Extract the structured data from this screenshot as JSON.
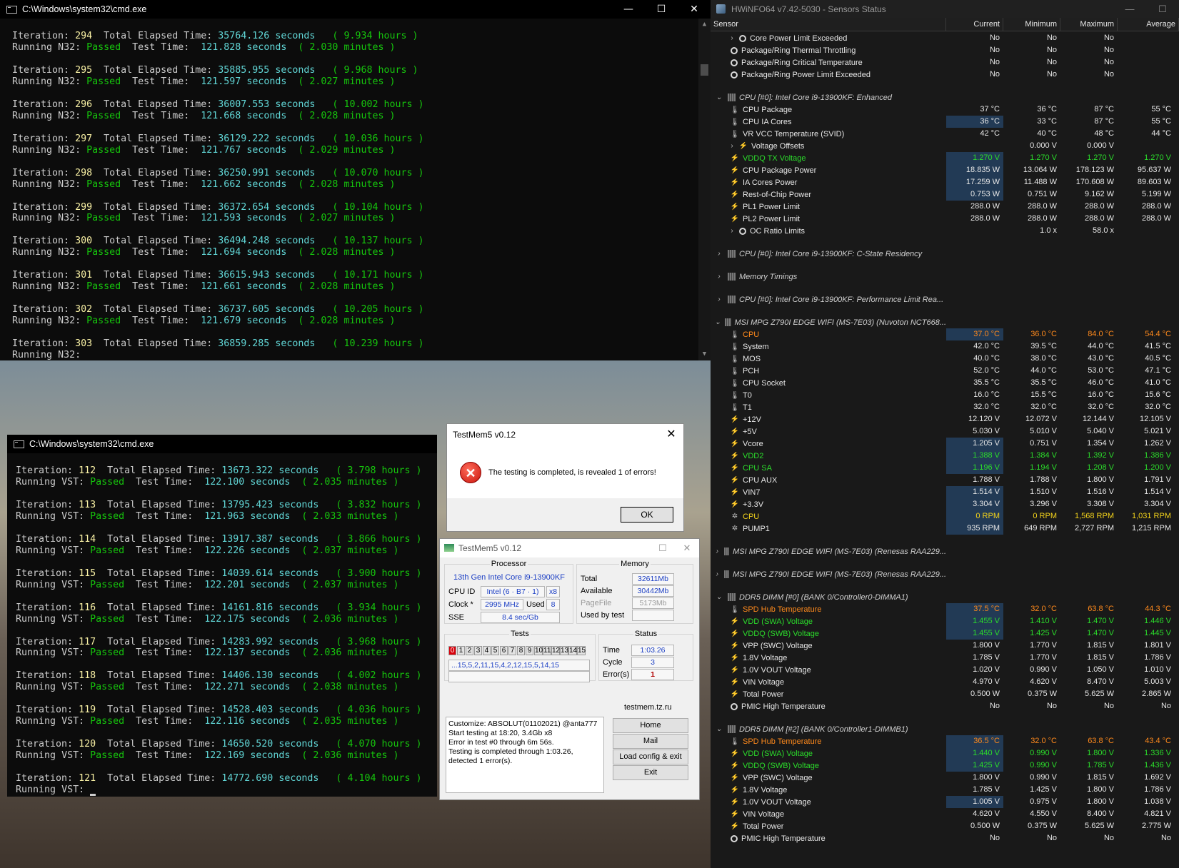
{
  "cmd1": {
    "title": "C:\\Windows\\system32\\cmd.exe",
    "blocks": [
      {
        "iter": "294",
        "elapsed": "35764.126",
        "hours": "9.934",
        "test": "N32:",
        "status": "Passed",
        "ttime": "121.828",
        "minutes": "2.030"
      },
      {
        "iter": "295",
        "elapsed": "35885.955",
        "hours": "9.968",
        "test": "N32:",
        "status": "Passed",
        "ttime": "121.597",
        "minutes": "2.027"
      },
      {
        "iter": "296",
        "elapsed": "36007.553",
        "hours": "10.002",
        "test": "N32:",
        "status": "Passed",
        "ttime": "121.668",
        "minutes": "2.028"
      },
      {
        "iter": "297",
        "elapsed": "36129.222",
        "hours": "10.036",
        "test": "N32:",
        "status": "Passed",
        "ttime": "121.767",
        "minutes": "2.029"
      },
      {
        "iter": "298",
        "elapsed": "36250.991",
        "hours": "10.070",
        "test": "N32:",
        "status": "Passed",
        "ttime": "121.662",
        "minutes": "2.028"
      },
      {
        "iter": "299",
        "elapsed": "36372.654",
        "hours": "10.104",
        "test": "N32:",
        "status": "Passed",
        "ttime": "121.593",
        "minutes": "2.027"
      },
      {
        "iter": "300",
        "elapsed": "36494.248",
        "hours": "10.137",
        "test": "N32:",
        "status": "Passed",
        "ttime": "121.694",
        "minutes": "2.028"
      },
      {
        "iter": "301",
        "elapsed": "36615.943",
        "hours": "10.171",
        "test": "N32:",
        "status": "Passed",
        "ttime": "121.661",
        "minutes": "2.028"
      },
      {
        "iter": "302",
        "elapsed": "36737.605",
        "hours": "10.205",
        "test": "N32:",
        "status": "Passed",
        "ttime": "121.679",
        "minutes": "2.028"
      },
      {
        "iter": "303",
        "elapsed": "36859.285",
        "hours": "10.239",
        "test": "N32:",
        "status": "",
        "ttime": "",
        "minutes": ""
      }
    ]
  },
  "cmd2": {
    "title": "C:\\Windows\\system32\\cmd.exe",
    "blocks": [
      {
        "iter": "112",
        "elapsed": "13673.322",
        "hours": "3.798",
        "test": "VST:",
        "status": "Passed",
        "ttime": "122.100",
        "minutes": "2.035"
      },
      {
        "iter": "113",
        "elapsed": "13795.423",
        "hours": "3.832",
        "test": "VST:",
        "status": "Passed",
        "ttime": "121.963",
        "minutes": "2.033"
      },
      {
        "iter": "114",
        "elapsed": "13917.387",
        "hours": "3.866",
        "test": "VST:",
        "status": "Passed",
        "ttime": "122.226",
        "minutes": "2.037"
      },
      {
        "iter": "115",
        "elapsed": "14039.614",
        "hours": "3.900",
        "test": "VST:",
        "status": "Passed",
        "ttime": "122.201",
        "minutes": "2.037"
      },
      {
        "iter": "116",
        "elapsed": "14161.816",
        "hours": "3.934",
        "test": "VST:",
        "status": "Passed",
        "ttime": "122.175",
        "minutes": "2.036"
      },
      {
        "iter": "117",
        "elapsed": "14283.992",
        "hours": "3.968",
        "test": "VST:",
        "status": "Passed",
        "ttime": "122.137",
        "minutes": "2.036"
      },
      {
        "iter": "118",
        "elapsed": "14406.130",
        "hours": "4.002",
        "test": "VST:",
        "status": "Passed",
        "ttime": "122.271",
        "minutes": "2.038"
      },
      {
        "iter": "119",
        "elapsed": "14528.403",
        "hours": "4.036",
        "test": "VST:",
        "status": "Passed",
        "ttime": "122.116",
        "minutes": "2.035"
      },
      {
        "iter": "120",
        "elapsed": "14650.520",
        "hours": "4.070",
        "test": "VST:",
        "status": "Passed",
        "ttime": "122.169",
        "minutes": "2.036"
      },
      {
        "iter": "121",
        "elapsed": "14772.690",
        "hours": "4.104",
        "test": "VST:",
        "status": "",
        "ttime": "",
        "minutes": ""
      }
    ]
  },
  "console_words": {
    "iteration": "Iteration:",
    "total": "Total Elapsed Time:",
    "seconds": "seconds",
    "hours": "hours",
    "running": "Running",
    "testtime": "Test Time:",
    "minutes": "minutes",
    "open": "(",
    "close": ")"
  },
  "window_buttons": {
    "minimize": "—",
    "maximize": "☐",
    "close": "✕"
  },
  "hwinfo": {
    "title": "HWiNFO64 v7.42-5030 - Sensors Status",
    "columns": [
      "Sensor",
      "Current",
      "Minimum",
      "Maximum",
      "Average"
    ],
    "rows": [
      {
        "k": "sub",
        "icon": "circ",
        "exp": "›",
        "label": "Core Power Limit Exceeded",
        "c": "No",
        "mn": "No",
        "mx": "No",
        "av": ""
      },
      {
        "k": "item",
        "icon": "circ",
        "label": "Package/Ring Thermal Throttling",
        "c": "No",
        "mn": "No",
        "mx": "No",
        "av": ""
      },
      {
        "k": "item",
        "icon": "circ",
        "label": "Package/Ring Critical Temperature",
        "c": "No",
        "mn": "No",
        "mx": "No",
        "av": ""
      },
      {
        "k": "item",
        "icon": "circ",
        "label": "Package/Ring Power Limit Exceeded",
        "c": "No",
        "mn": "No",
        "mx": "No",
        "av": ""
      },
      {
        "k": "gap"
      },
      {
        "k": "group",
        "exp": "⌄",
        "label": "CPU [#0]: Intel Core i9-13900KF: Enhanced"
      },
      {
        "k": "item",
        "icon": "therm",
        "label": "CPU Package",
        "c": "37 °C",
        "mn": "36 °C",
        "mx": "87 °C",
        "av": "55 °C"
      },
      {
        "k": "item",
        "icon": "therm",
        "label": "CPU IA Cores",
        "c": "36 °C",
        "mn": "33 °C",
        "mx": "87 °C",
        "av": "55 °C",
        "hl": true
      },
      {
        "k": "item",
        "icon": "therm",
        "label": "VR VCC Temperature (SVID)",
        "c": "42 °C",
        "mn": "40 °C",
        "mx": "48 °C",
        "av": "44 °C"
      },
      {
        "k": "sub",
        "icon": "volt",
        "exp": "›",
        "label": "Voltage Offsets",
        "c": "",
        "mn": "0.000 V",
        "mx": "0.000 V",
        "av": ""
      },
      {
        "k": "item",
        "icon": "volt",
        "label": "VDDQ TX Voltage",
        "c": "1.270 V",
        "mn": "1.270 V",
        "mx": "1.270 V",
        "av": "1.270 V",
        "color": "green",
        "hl": true
      },
      {
        "k": "item",
        "icon": "volt",
        "label": "CPU Package Power",
        "c": "18.835 W",
        "mn": "13.064 W",
        "mx": "178.123 W",
        "av": "95.637 W",
        "hl": true
      },
      {
        "k": "item",
        "icon": "volt",
        "label": "IA Cores Power",
        "c": "17.259 W",
        "mn": "11.488 W",
        "mx": "170.608 W",
        "av": "89.603 W",
        "hl": true
      },
      {
        "k": "item",
        "icon": "volt",
        "label": "Rest-of-Chip Power",
        "c": "0.753 W",
        "mn": "0.751 W",
        "mx": "9.162 W",
        "av": "5.199 W",
        "hl": true
      },
      {
        "k": "item",
        "icon": "volt",
        "label": "PL1 Power Limit",
        "c": "288.0 W",
        "mn": "288.0 W",
        "mx": "288.0 W",
        "av": "288.0 W"
      },
      {
        "k": "item",
        "icon": "volt",
        "label": "PL2 Power Limit",
        "c": "288.0 W",
        "mn": "288.0 W",
        "mx": "288.0 W",
        "av": "288.0 W"
      },
      {
        "k": "sub",
        "icon": "circ",
        "exp": "›",
        "label": "OC Ratio Limits",
        "c": "",
        "mn": "1.0 x",
        "mx": "58.0 x",
        "av": ""
      },
      {
        "k": "gap"
      },
      {
        "k": "group",
        "exp": "›",
        "label": "CPU [#0]: Intel Core i9-13900KF: C-State Residency"
      },
      {
        "k": "gap"
      },
      {
        "k": "group",
        "exp": "›",
        "label": "Memory Timings"
      },
      {
        "k": "gap"
      },
      {
        "k": "group",
        "exp": "›",
        "label": "CPU [#0]: Intel Core i9-13900KF: Performance Limit Rea..."
      },
      {
        "k": "gap"
      },
      {
        "k": "group",
        "exp": "⌄",
        "label": "MSI MPG Z790I EDGE WIFI (MS-7E03) (Nuvoton NCT668..."
      },
      {
        "k": "item",
        "icon": "therm",
        "label": "CPU",
        "c": "37.0 °C",
        "mn": "36.0 °C",
        "mx": "84.0 °C",
        "av": "54.4 °C",
        "color": "orange",
        "hl": true
      },
      {
        "k": "item",
        "icon": "therm",
        "label": "System",
        "c": "42.0 °C",
        "mn": "39.5 °C",
        "mx": "44.0 °C",
        "av": "41.5 °C"
      },
      {
        "k": "item",
        "icon": "therm",
        "label": "MOS",
        "c": "40.0 °C",
        "mn": "38.0 °C",
        "mx": "43.0 °C",
        "av": "40.5 °C"
      },
      {
        "k": "item",
        "icon": "therm",
        "label": "PCH",
        "c": "52.0 °C",
        "mn": "44.0 °C",
        "mx": "53.0 °C",
        "av": "47.1 °C"
      },
      {
        "k": "item",
        "icon": "therm",
        "label": "CPU Socket",
        "c": "35.5 °C",
        "mn": "35.5 °C",
        "mx": "46.0 °C",
        "av": "41.0 °C"
      },
      {
        "k": "item",
        "icon": "therm",
        "label": "T0",
        "c": "16.0 °C",
        "mn": "15.5 °C",
        "mx": "16.0 °C",
        "av": "15.6 °C"
      },
      {
        "k": "item",
        "icon": "therm",
        "label": "T1",
        "c": "32.0 °C",
        "mn": "32.0 °C",
        "mx": "32.0 °C",
        "av": "32.0 °C"
      },
      {
        "k": "item",
        "icon": "volt",
        "label": "+12V",
        "c": "12.120 V",
        "mn": "12.072 V",
        "mx": "12.144 V",
        "av": "12.105 V"
      },
      {
        "k": "item",
        "icon": "volt",
        "label": "+5V",
        "c": "5.030 V",
        "mn": "5.010 V",
        "mx": "5.040 V",
        "av": "5.021 V"
      },
      {
        "k": "item",
        "icon": "volt",
        "label": "Vcore",
        "c": "1.205 V",
        "mn": "0.751 V",
        "mx": "1.354 V",
        "av": "1.262 V",
        "hl": true
      },
      {
        "k": "item",
        "icon": "volt",
        "label": "VDD2",
        "c": "1.388 V",
        "mn": "1.384 V",
        "mx": "1.392 V",
        "av": "1.386 V",
        "color": "green",
        "hl": true
      },
      {
        "k": "item",
        "icon": "volt",
        "label": "CPU SA",
        "c": "1.196 V",
        "mn": "1.194 V",
        "mx": "1.208 V",
        "av": "1.200 V",
        "color": "green",
        "hl": true
      },
      {
        "k": "item",
        "icon": "volt",
        "label": "CPU AUX",
        "c": "1.788 V",
        "mn": "1.788 V",
        "mx": "1.800 V",
        "av": "1.791 V"
      },
      {
        "k": "item",
        "icon": "volt",
        "label": "VIN7",
        "c": "1.514 V",
        "mn": "1.510 V",
        "mx": "1.516 V",
        "av": "1.514 V",
        "hl": true
      },
      {
        "k": "item",
        "icon": "volt",
        "label": "+3.3V",
        "c": "3.304 V",
        "mn": "3.296 V",
        "mx": "3.308 V",
        "av": "3.304 V",
        "hl": true
      },
      {
        "k": "item",
        "icon": "fan",
        "label": "CPU",
        "c": "0 RPM",
        "mn": "0 RPM",
        "mx": "1,568 RPM",
        "av": "1,031 RPM",
        "color": "yellow",
        "hl": true
      },
      {
        "k": "item",
        "icon": "fan",
        "label": "PUMP1",
        "c": "935 RPM",
        "mn": "649 RPM",
        "mx": "2,727 RPM",
        "av": "1,215 RPM",
        "hl": true
      },
      {
        "k": "gap"
      },
      {
        "k": "group",
        "exp": "›",
        "label": "MSI MPG Z790I EDGE WIFI (MS-7E03) (Renesas RAA229..."
      },
      {
        "k": "gap"
      },
      {
        "k": "group",
        "exp": "›",
        "label": "MSI MPG Z790I EDGE WIFI (MS-7E03) (Renesas RAA229..."
      },
      {
        "k": "gap"
      },
      {
        "k": "group",
        "exp": "⌄",
        "label": "DDR5 DIMM [#0] (BANK 0/Controller0-DIMMA1)"
      },
      {
        "k": "item",
        "icon": "therm",
        "label": "SPD Hub Temperature",
        "c": "37.5 °C",
        "mn": "32.0 °C",
        "mx": "63.8 °C",
        "av": "44.3 °C",
        "color": "orange",
        "hl": true
      },
      {
        "k": "item",
        "icon": "volt",
        "label": "VDD (SWA) Voltage",
        "c": "1.455 V",
        "mn": "1.410 V",
        "mx": "1.470 V",
        "av": "1.446 V",
        "color": "green",
        "hl": true
      },
      {
        "k": "item",
        "icon": "volt",
        "label": "VDDQ (SWB) Voltage",
        "c": "1.455 V",
        "mn": "1.425 V",
        "mx": "1.470 V",
        "av": "1.445 V",
        "color": "green",
        "hl": true
      },
      {
        "k": "item",
        "icon": "volt",
        "label": "VPP (SWC) Voltage",
        "c": "1.800 V",
        "mn": "1.770 V",
        "mx": "1.815 V",
        "av": "1.801 V"
      },
      {
        "k": "item",
        "icon": "volt",
        "label": "1.8V Voltage",
        "c": "1.785 V",
        "mn": "1.770 V",
        "mx": "1.815 V",
        "av": "1.786 V"
      },
      {
        "k": "item",
        "icon": "volt",
        "label": "1.0V VOUT Voltage",
        "c": "1.020 V",
        "mn": "0.990 V",
        "mx": "1.050 V",
        "av": "1.010 V"
      },
      {
        "k": "item",
        "icon": "volt",
        "label": "VIN Voltage",
        "c": "4.970 V",
        "mn": "4.620 V",
        "mx": "8.470 V",
        "av": "5.003 V"
      },
      {
        "k": "item",
        "icon": "volt",
        "label": "Total Power",
        "c": "0.500 W",
        "mn": "0.375 W",
        "mx": "5.625 W",
        "av": "2.865 W"
      },
      {
        "k": "item",
        "icon": "circ",
        "label": "PMIC High Temperature",
        "c": "No",
        "mn": "No",
        "mx": "No",
        "av": "No"
      },
      {
        "k": "gap"
      },
      {
        "k": "group",
        "exp": "⌄",
        "label": "DDR5 DIMM [#2] (BANK 0/Controller1-DIMMB1)"
      },
      {
        "k": "item",
        "icon": "therm",
        "label": "SPD Hub Temperature",
        "c": "36.5 °C",
        "mn": "32.0 °C",
        "mx": "63.8 °C",
        "av": "43.4 °C",
        "color": "orange",
        "hl": true
      },
      {
        "k": "item",
        "icon": "volt",
        "label": "VDD (SWA) Voltage",
        "c": "1.440 V",
        "mn": "0.990 V",
        "mx": "1.800 V",
        "av": "1.336 V",
        "color": "green",
        "hl": true
      },
      {
        "k": "item",
        "icon": "volt",
        "label": "VDDQ (SWB) Voltage",
        "c": "1.425 V",
        "mn": "0.990 V",
        "mx": "1.785 V",
        "av": "1.436 V",
        "color": "green",
        "hl": true
      },
      {
        "k": "item",
        "icon": "volt",
        "label": "VPP (SWC) Voltage",
        "c": "1.800 V",
        "mn": "0.990 V",
        "mx": "1.815 V",
        "av": "1.692 V"
      },
      {
        "k": "item",
        "icon": "volt",
        "label": "1.8V Voltage",
        "c": "1.785 V",
        "mn": "1.425 V",
        "mx": "1.800 V",
        "av": "1.786 V"
      },
      {
        "k": "item",
        "icon": "volt",
        "label": "1.0V VOUT Voltage",
        "c": "1.005 V",
        "mn": "0.975 V",
        "mx": "1.800 V",
        "av": "1.038 V",
        "hl": true
      },
      {
        "k": "item",
        "icon": "volt",
        "label": "VIN Voltage",
        "c": "4.620 V",
        "mn": "4.550 V",
        "mx": "8.400 V",
        "av": "4.821 V"
      },
      {
        "k": "item",
        "icon": "volt",
        "label": "Total Power",
        "c": "0.500 W",
        "mn": "0.375 W",
        "mx": "5.625 W",
        "av": "2.775 W"
      },
      {
        "k": "item",
        "icon": "circ",
        "label": "PMIC High Temperature",
        "c": "No",
        "mn": "No",
        "mx": "No",
        "av": "No"
      }
    ]
  },
  "msgbox": {
    "title": "TestMem5 v0.12",
    "message": "The testing is completed, is revealed 1 of errors!",
    "ok": "OK",
    "error_icon_glyph": "✕"
  },
  "testmem": {
    "title": "TestMem5 v0.12",
    "processor_legend": "Processor",
    "cpu_name": "13th Gen Intel Core i9-13900KF",
    "cpu_id_label": "CPU ID",
    "cpu_id": "Intel (6 · B7 · 1)",
    "cpu_threads": "x8",
    "clock_label": "Clock *",
    "clock": "2995 MHz",
    "used_label": "Used",
    "used": "8",
    "sse_label": "SSE",
    "sse": "8.4 sec/Gb",
    "memory_legend": "Memory",
    "total_label": "Total",
    "total": "32611Mb",
    "available_label": "Available",
    "available": "30442Mb",
    "pagefile_label": "PageFile",
    "pagefile": "5173Mb",
    "usedbytest_label": "Used by test",
    "usedbytest": "",
    "tests_legend": "Tests",
    "tests": [
      "0",
      "1",
      "2",
      "3",
      "4",
      "5",
      "6",
      "7",
      "8",
      "9",
      "10",
      "11",
      "12",
      "13",
      "14",
      "15"
    ],
    "test_sequence": "...15,5,2,11,15,4,2,12,15,5,14,15",
    "status_legend": "Status",
    "time_label": "Time",
    "time": "1:03.26",
    "cycle_label": "Cycle",
    "cycle": "3",
    "errors_label": "Error(s)",
    "errors": "1",
    "log": "Customize: ABSOLUT(01102021) @anta777\nStart testing at 18:20, 3.4Gb x8\nError in test #0 through 6m 56s.\nTesting is completed through 1:03.26,\ndetected 1 error(s).",
    "site": "testmem.tz.ru",
    "home": "Home",
    "mail": "Mail",
    "load_config": "Load config & exit",
    "exit": "Exit"
  },
  "colors": {
    "console_bg": "#0c0c0c",
    "green": "#16c60c",
    "yellow": "#f9f1a5",
    "cyan": "#61d6d6",
    "hw_green": "#2bdc2b",
    "hw_orange": "#ff8a1c",
    "error_red": "#d9000b"
  }
}
